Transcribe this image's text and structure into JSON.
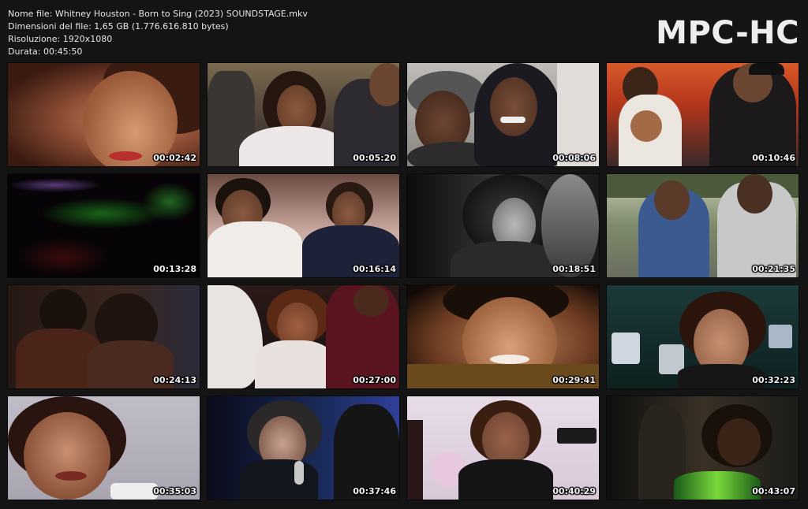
{
  "file_info": {
    "name_line": "Nome file: Whitney Houston - Born to Sing (2023) SOUNDSTAGE.mkv",
    "size_line": "Dimensioni del file: 1,65 GB (1.776.616.810 bytes)",
    "resolution_line": "Risoluzione: 1920x1080",
    "duration_line": "Durata: 00:45:50"
  },
  "brand": "MPC-HC",
  "thumbnails": [
    {
      "timestamp": "00:02:42"
    },
    {
      "timestamp": "00:05:20"
    },
    {
      "timestamp": "00:08:06"
    },
    {
      "timestamp": "00:10:46"
    },
    {
      "timestamp": "00:13:28"
    },
    {
      "timestamp": "00:16:14"
    },
    {
      "timestamp": "00:18:51"
    },
    {
      "timestamp": "00:21:35"
    },
    {
      "timestamp": "00:24:13"
    },
    {
      "timestamp": "00:27:00"
    },
    {
      "timestamp": "00:29:41"
    },
    {
      "timestamp": "00:32:23"
    },
    {
      "timestamp": "00:35:03"
    },
    {
      "timestamp": "00:37:46"
    },
    {
      "timestamp": "00:40:29"
    },
    {
      "timestamp": "00:43:07"
    }
  ]
}
